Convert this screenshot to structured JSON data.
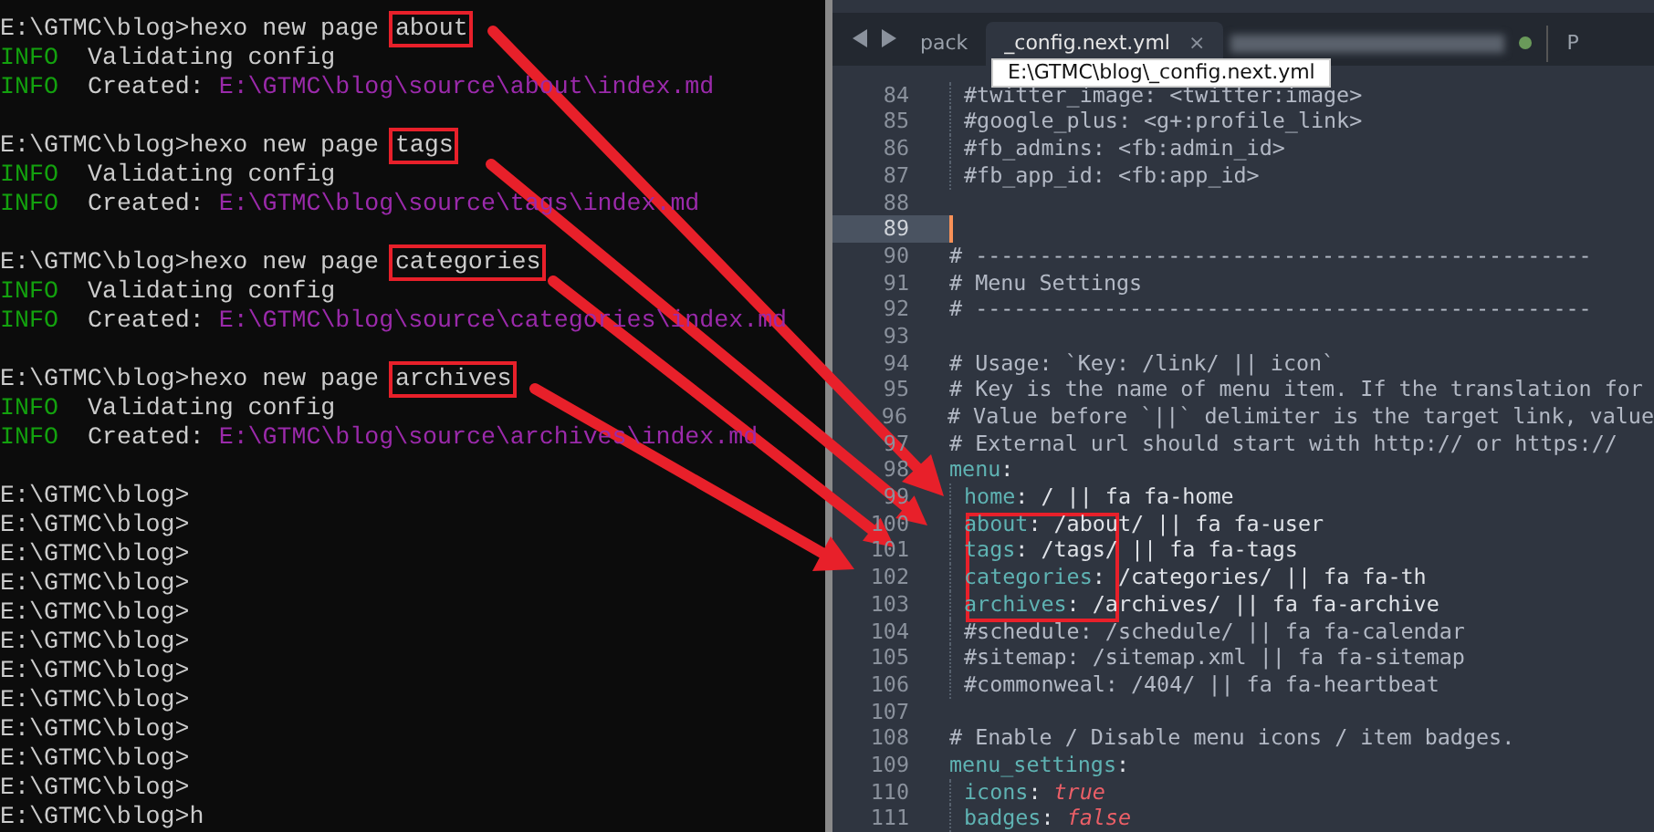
{
  "terminal": {
    "lines": [
      {
        "kind": "command",
        "prompt": "E:\\GTMC\\blog>",
        "text": "hexo new page ",
        "arg": "about"
      },
      {
        "kind": "info",
        "tag": "INFO",
        "message": "Validating config"
      },
      {
        "kind": "info",
        "tag": "INFO",
        "message": "Created:",
        "path": "E:\\GTMC\\blog\\source\\about\\index.md"
      },
      {
        "kind": "blank"
      },
      {
        "kind": "command",
        "prompt": "E:\\GTMC\\blog>",
        "text": "hexo new page ",
        "arg": "tags"
      },
      {
        "kind": "info",
        "tag": "INFO",
        "message": "Validating config"
      },
      {
        "kind": "info",
        "tag": "INFO",
        "message": "Created:",
        "path": "E:\\GTMC\\blog\\source\\tags\\index.md"
      },
      {
        "kind": "blank"
      },
      {
        "kind": "command",
        "prompt": "E:\\GTMC\\blog>",
        "text": "hexo new page ",
        "arg": "categories"
      },
      {
        "kind": "info",
        "tag": "INFO",
        "message": "Validating config"
      },
      {
        "kind": "info",
        "tag": "INFO",
        "message": "Created:",
        "path": "E:\\GTMC\\blog\\source\\categories\\index.md"
      },
      {
        "kind": "blank"
      },
      {
        "kind": "command",
        "prompt": "E:\\GTMC\\blog>",
        "text": "hexo new page ",
        "arg": "archives"
      },
      {
        "kind": "info",
        "tag": "INFO",
        "message": "Validating config"
      },
      {
        "kind": "info",
        "tag": "INFO",
        "message": "Created:",
        "path": "E:\\GTMC\\blog\\source\\archives\\index.md"
      },
      {
        "kind": "blank"
      },
      {
        "kind": "prompt",
        "text": "E:\\GTMC\\blog>"
      },
      {
        "kind": "prompt",
        "text": "E:\\GTMC\\blog>"
      },
      {
        "kind": "prompt",
        "text": "E:\\GTMC\\blog>"
      },
      {
        "kind": "prompt",
        "text": "E:\\GTMC\\blog>"
      },
      {
        "kind": "prompt",
        "text": "E:\\GTMC\\blog>"
      },
      {
        "kind": "prompt",
        "text": "E:\\GTMC\\blog>"
      },
      {
        "kind": "prompt",
        "text": "E:\\GTMC\\blog>"
      },
      {
        "kind": "prompt",
        "text": "E:\\GTMC\\blog>"
      },
      {
        "kind": "prompt",
        "text": "E:\\GTMC\\blog>"
      },
      {
        "kind": "prompt",
        "text": "E:\\GTMC\\blog>"
      },
      {
        "kind": "prompt",
        "text": "E:\\GTMC\\blog>"
      },
      {
        "kind": "prompt",
        "text": "E:\\GTMC\\blog>h"
      }
    ]
  },
  "editor": {
    "tabs": [
      {
        "label": "pack",
        "selected": false
      },
      {
        "label": "_config.next.yml",
        "selected": true,
        "close": "×"
      },
      {
        "label": "P",
        "selected": false
      }
    ],
    "tooltip": "E:\\GTMC\\blog\\_config.next.yml",
    "lines": [
      {
        "number": "84",
        "indented": true,
        "current": false,
        "segments": [
          {
            "kind": "comment",
            "text": "#twitter_image: <twitter:image>"
          }
        ]
      },
      {
        "number": "85",
        "indented": true,
        "current": false,
        "segments": [
          {
            "kind": "comment",
            "text": "#google_plus: <g+:profile_link>"
          }
        ]
      },
      {
        "number": "86",
        "indented": true,
        "current": false,
        "segments": [
          {
            "kind": "comment",
            "text": "#fb_admins: <fb:admin_id>"
          }
        ]
      },
      {
        "number": "87",
        "indented": true,
        "current": false,
        "segments": [
          {
            "kind": "comment",
            "text": "#fb_app_id: <fb:app_id>"
          }
        ]
      },
      {
        "number": "88",
        "indented": false,
        "current": false
      },
      {
        "number": "89",
        "indented": false,
        "current": true
      },
      {
        "number": "90",
        "indented": false,
        "current": false,
        "segments": [
          {
            "kind": "comment",
            "text": "# ------------------------------------------------"
          }
        ]
      },
      {
        "number": "91",
        "indented": false,
        "current": false,
        "segments": [
          {
            "kind": "comment",
            "text": "# Menu Settings"
          }
        ]
      },
      {
        "number": "92",
        "indented": false,
        "current": false,
        "segments": [
          {
            "kind": "comment",
            "text": "# ------------------------------------------------"
          }
        ]
      },
      {
        "number": "93",
        "indented": false,
        "current": false
      },
      {
        "number": "94",
        "indented": false,
        "current": false,
        "segments": [
          {
            "kind": "comment",
            "text": "# Usage: `Key: /link/ || icon`"
          }
        ]
      },
      {
        "number": "95",
        "indented": false,
        "current": false,
        "segments": [
          {
            "kind": "comment",
            "text": "# Key is the name of menu item. If the translation for"
          }
        ]
      },
      {
        "number": "96",
        "indented": false,
        "current": false,
        "segments": [
          {
            "kind": "comment",
            "text": "# Value before `||` delimiter is the target link, value"
          }
        ]
      },
      {
        "number": "97",
        "indented": false,
        "current": false,
        "segments": [
          {
            "kind": "comment",
            "text": "# External url should start with http:// or https://"
          }
        ]
      },
      {
        "number": "98",
        "indented": false,
        "current": false,
        "segments": [
          {
            "kind": "key",
            "text": "menu"
          },
          {
            "kind": "plain",
            "text": ":"
          }
        ],
        "children": [
          {
            "number": "99",
            "current": false,
            "segments": [
              {
                "kind": "key",
                "text": "home"
              },
              {
                "kind": "plain",
                "text": ": / || fa fa-home"
              }
            ]
          },
          {
            "number": "100",
            "current": false,
            "segments": [
              {
                "kind": "key",
                "text": "about"
              },
              {
                "kind": "plain",
                "text": ": /about/ || fa fa-user"
              }
            ]
          },
          {
            "number": "101",
            "current": false,
            "segments": [
              {
                "kind": "key",
                "text": "tags"
              },
              {
                "kind": "plain",
                "text": ": /tags/ || fa fa-tags"
              }
            ]
          },
          {
            "number": "102",
            "current": false,
            "segments": [
              {
                "kind": "key",
                "text": "categories"
              },
              {
                "kind": "plain",
                "text": ": /categories/ || fa fa-th"
              }
            ]
          },
          {
            "number": "103",
            "current": false,
            "segments": [
              {
                "kind": "key",
                "text": "archives"
              },
              {
                "kind": "plain",
                "text": ": /archives/ || fa fa-archive"
              }
            ]
          },
          {
            "number": "104",
            "current": false,
            "segments": [
              {
                "kind": "comment",
                "text": "#schedule: /schedule/ || fa fa-calendar"
              }
            ]
          },
          {
            "number": "105",
            "current": false,
            "segments": [
              {
                "kind": "comment",
                "text": "#sitemap: /sitemap.xml || fa fa-sitemap"
              }
            ]
          },
          {
            "number": "106",
            "current": false,
            "segments": [
              {
                "kind": "comment",
                "text": "#commonweal: /404/ || fa fa-heartbeat"
              }
            ]
          }
        ]
      },
      {
        "number": "107",
        "indented": false,
        "current": false
      },
      {
        "number": "108",
        "indented": false,
        "current": false,
        "segments": [
          {
            "kind": "comment",
            "text": "# Enable / Disable menu icons / item badges."
          }
        ]
      },
      {
        "number": "109",
        "indented": false,
        "current": false,
        "segments": [
          {
            "kind": "key",
            "text": "menu_settings"
          },
          {
            "kind": "plain",
            "text": ":"
          }
        ],
        "children": [
          {
            "number": "110",
            "current": false,
            "segments": [
              {
                "kind": "key",
                "text": "icons"
              },
              {
                "kind": "plain",
                "text": ": "
              },
              {
                "kind": "bool",
                "text": "true"
              }
            ]
          },
          {
            "number": "111",
            "current": false,
            "segments": [
              {
                "kind": "key",
                "text": "badges"
              },
              {
                "kind": "plain",
                "text": ": "
              },
              {
                "kind": "bool",
                "text": "false"
              }
            ]
          }
        ]
      }
    ]
  }
}
